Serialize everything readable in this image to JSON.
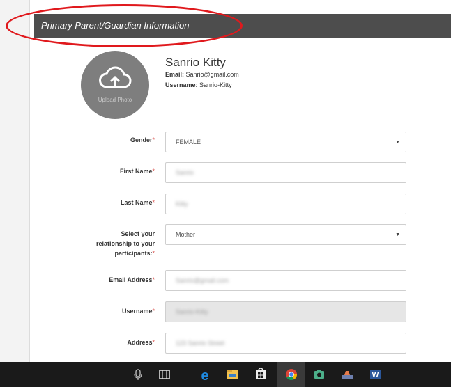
{
  "section": {
    "title": "Primary Parent/Guardian Information"
  },
  "photo": {
    "label": "Upload Photo"
  },
  "profile": {
    "name": "Sanrio Kitty",
    "email_label": "Email:",
    "email_value": "Sanrio@gmail.com",
    "username_label": "Username:",
    "username_value": "Sanrio-Kitty"
  },
  "form": {
    "gender": {
      "label": "Gender",
      "required": "*",
      "value": "FEMALE"
    },
    "first_name": {
      "label": "First Name",
      "required": "*",
      "value": "Sanrio"
    },
    "last_name": {
      "label": "Last Name",
      "required": "*",
      "value": "Kitty"
    },
    "relationship": {
      "label_line1": "Select your",
      "label_line2": "relationship to your",
      "label_line3": "participants:",
      "required": "*",
      "value": "Mother"
    },
    "email": {
      "label": "Email Address",
      "required": "*",
      "value": "Sanrio@gmail.com"
    },
    "username": {
      "label": "Username",
      "required": "*",
      "value": "Sanrio-Kitty"
    },
    "address": {
      "label": "Address",
      "required": "*",
      "value": "123 Sanrio Street"
    }
  },
  "taskbar": {
    "icons": [
      "microphone-icon",
      "task-view-icon",
      "edge-icon",
      "file-explorer-icon",
      "store-icon",
      "chrome-icon",
      "camera-app-icon",
      "ink-icon",
      "word-icon"
    ]
  },
  "colors": {
    "header_bg": "#4d4d4d",
    "annotation": "#e0191d",
    "required": "#d9534f",
    "photo_bg": "#7e7e7e",
    "taskbar_bg": "#1a1a1a"
  }
}
